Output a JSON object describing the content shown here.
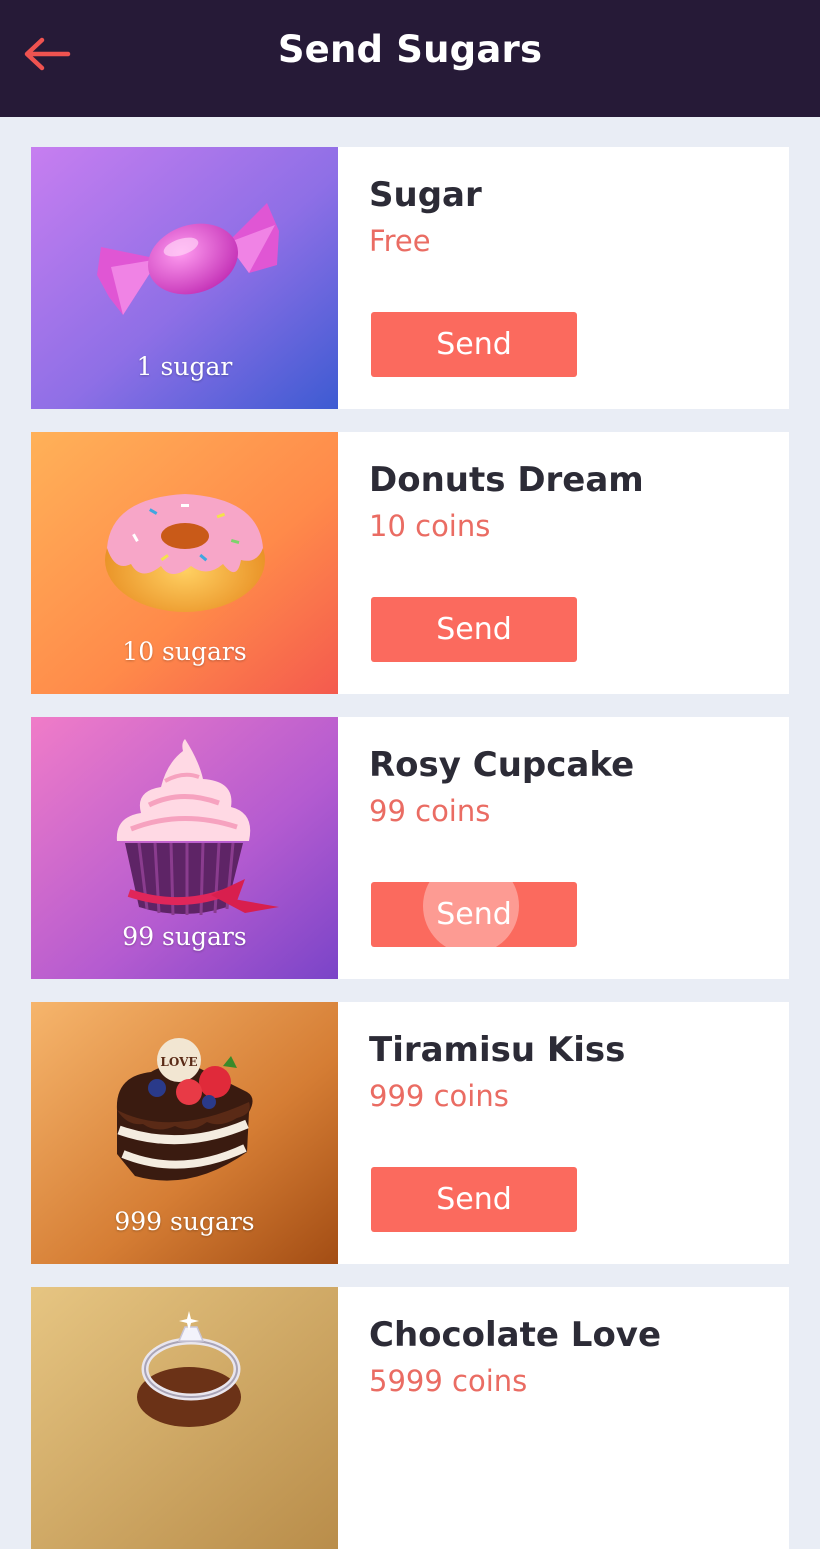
{
  "header": {
    "title": "Send Sugars",
    "back_icon": "arrow-left-icon",
    "back_color": "#ef5350",
    "background": "#261a37"
  },
  "accent": "#fb6a5e",
  "price_color": "#ea6c63",
  "gifts": [
    {
      "name": "Sugar",
      "price": "Free",
      "quantity": "1 sugar",
      "button": "Send",
      "icon": "candy-icon"
    },
    {
      "name": "Donuts Dream",
      "price": "10 coins",
      "quantity": "10 sugars",
      "button": "Send",
      "icon": "donut-icon"
    },
    {
      "name": "Rosy Cupcake",
      "price": "99 coins",
      "quantity": "99 sugars",
      "button": "Send",
      "icon": "cupcake-icon"
    },
    {
      "name": "Tiramisu Kiss",
      "price": "999 coins",
      "quantity": "999 sugars",
      "button": "Send",
      "icon": "cake-icon"
    },
    {
      "name": "Chocolate Love",
      "price": "5999 coins",
      "quantity": "",
      "button": "",
      "icon": "ring-icon"
    }
  ]
}
